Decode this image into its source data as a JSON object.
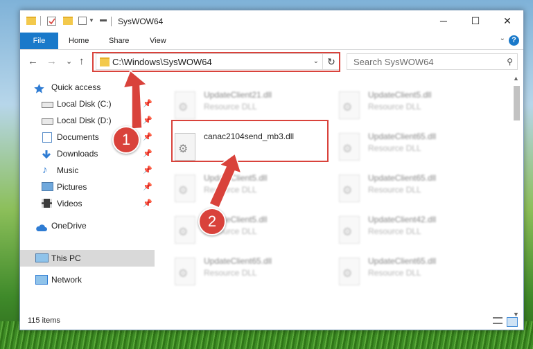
{
  "window": {
    "title": "SysWOW64",
    "controls": {
      "minimize": "─",
      "maximize": "☐",
      "close": "✕"
    }
  },
  "ribbon": {
    "tabs": [
      "File",
      "Home",
      "Share",
      "View"
    ],
    "expand_glyph": "⌄",
    "help_glyph": "?"
  },
  "navigation": {
    "back_glyph": "←",
    "forward_glyph": "→",
    "recent_glyph": "⌄",
    "up_glyph": "↑",
    "address": "C:\\Windows\\SysWOW64",
    "address_chevron": "⌄",
    "refresh_glyph": "↻",
    "search_placeholder": "Search SysWOW64",
    "search_glyph": "⚲"
  },
  "sidebar": {
    "items": [
      {
        "label": "Quick access",
        "icon": "star-icon",
        "pinned": false
      },
      {
        "label": "Local Disk (C:)",
        "icon": "drive-icon",
        "pinned": true
      },
      {
        "label": "Local Disk (D:)",
        "icon": "drive-icon",
        "pinned": true
      },
      {
        "label": "Documents",
        "icon": "documents-icon",
        "pinned": true
      },
      {
        "label": "Downloads",
        "icon": "download-icon",
        "pinned": true
      },
      {
        "label": "Music",
        "icon": "music-icon",
        "pinned": true
      },
      {
        "label": "Pictures",
        "icon": "pictures-icon",
        "pinned": true
      },
      {
        "label": "Videos",
        "icon": "videos-icon",
        "pinned": true
      },
      {
        "label": "OneDrive",
        "icon": "cloud-icon",
        "pinned": false
      },
      {
        "label": "This PC",
        "icon": "computer-icon",
        "pinned": false,
        "selected": true
      },
      {
        "label": "Network",
        "icon": "network-icon",
        "pinned": false
      }
    ],
    "pin_glyph": "📌"
  },
  "files": [
    {
      "name": "UpdateClient21.dll",
      "type": "Resource DLL",
      "blurred": true
    },
    {
      "name": "UpdateClient5.dll",
      "type": "Resource DLL",
      "blurred": true
    },
    {
      "name": "canac2104send_mb3.dll",
      "type": "",
      "blurred": false,
      "highlighted": true
    },
    {
      "name": "UpdateClient65.dll",
      "type": "Resource DLL",
      "blurred": true
    },
    {
      "name": "UpdateClient5.dll",
      "type": "Resource DLL",
      "blurred": true
    },
    {
      "name": "UpdateClient65.dll",
      "type": "Resource DLL",
      "blurred": true
    },
    {
      "name": "UpdateClient5.dll",
      "type": "Resource DLL",
      "blurred": true
    },
    {
      "name": "UpdateClient42.dll",
      "type": "Resource DLL",
      "blurred": true
    },
    {
      "name": "UpdateClient65.dll",
      "type": "Resource DLL",
      "blurred": true
    },
    {
      "name": "UpdateClient65.dll",
      "type": "Resource DLL",
      "blurred": true
    }
  ],
  "status": {
    "item_count": "115 items"
  },
  "annotations": {
    "step1": "1",
    "step2": "2"
  },
  "colors": {
    "accent": "#1979ca",
    "annotation_red": "#d9423b",
    "selected_bg": "#d9d9d9"
  }
}
